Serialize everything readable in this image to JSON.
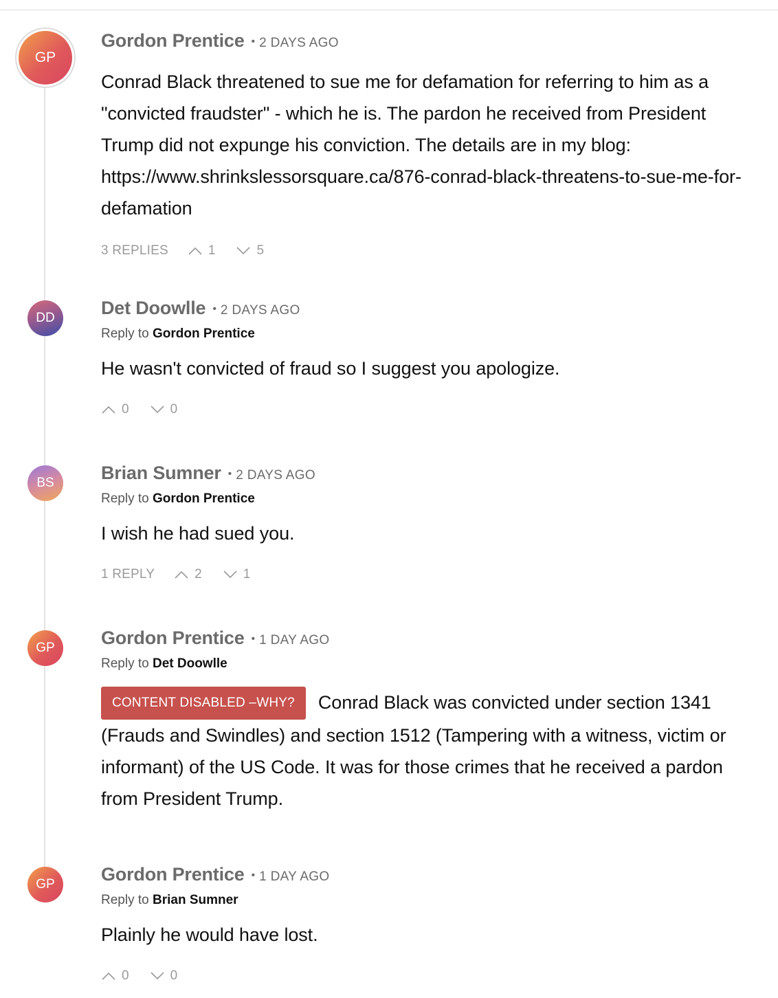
{
  "comments": [
    {
      "avatar": "GP",
      "author": "Gordon Prentice",
      "time": "2 DAYS AGO",
      "text": "Conrad Black threatened to sue me for defamation for referring to him as a \"convicted fraudster\" - which he is. The pardon he received from President Trump did not expunge his conviction. The details are in my blog: https://www.shrinkslessorsquare.ca/876-conrad-black-threatens-to-sue-me-for-defamation",
      "replies": "3 REPLIES",
      "upvotes": "1",
      "downvotes": "5"
    },
    {
      "avatar": "DD",
      "author": "Det Doowlle",
      "time": "2 DAYS AGO",
      "reply_prefix": "Reply to",
      "reply_to": "Gordon Prentice",
      "text": "He wasn't convicted of fraud so I suggest you apologize.",
      "upvotes": "0",
      "downvotes": "0"
    },
    {
      "avatar": "BS",
      "author": "Brian Sumner",
      "time": "2 DAYS AGO",
      "reply_prefix": "Reply to",
      "reply_to": "Gordon Prentice",
      "text": "I wish he had sued you.",
      "replies": "1 REPLY",
      "upvotes": "2",
      "downvotes": "1"
    },
    {
      "avatar": "GP",
      "author": "Gordon Prentice",
      "time": "1 DAY AGO",
      "reply_prefix": "Reply to",
      "reply_to": "Det Doowlle",
      "badge": "CONTENT DISABLED –WHY?",
      "text": "Conrad Black was convicted under section 1341 (Frauds and Swindles) and section 1512 (Tampering with a witness, victim or informant) of the US Code. It was for those crimes that he received a pardon from President Trump."
    },
    {
      "avatar": "GP",
      "author": "Gordon Prentice",
      "time": "1 DAY AGO",
      "reply_prefix": "Reply to",
      "reply_to": "Brian Sumner",
      "text": "Plainly he would have lost.",
      "upvotes": "0",
      "downvotes": "0"
    }
  ],
  "icons": {
    "upvote": "chevron-up-icon",
    "downvote": "chevron-down-icon"
  },
  "colors": {
    "badge": "#c6514d",
    "meta": "#6b6b6b",
    "actions": "#9a9a9a"
  }
}
